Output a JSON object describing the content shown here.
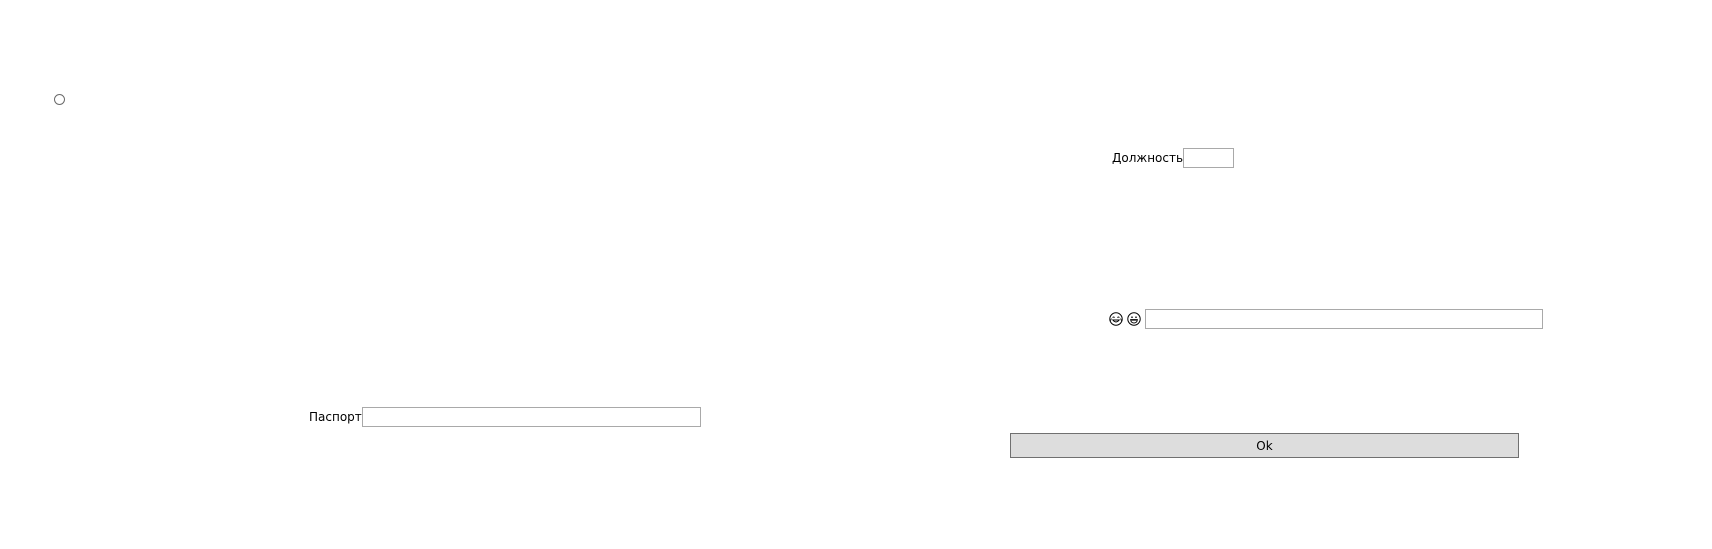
{
  "radio": {
    "checked": false
  },
  "position_field": {
    "label": "Должность",
    "value": "",
    "placeholder": ""
  },
  "emoji_field": {
    "icons": [
      "crying-laughing-face-icon",
      "grinning-face-icon"
    ],
    "value": "",
    "placeholder": ""
  },
  "passport_field": {
    "label": "Паспорт",
    "value": "",
    "placeholder": ""
  },
  "ok_button": {
    "label": "Ok"
  },
  "colors": {
    "button_bg": "#dddddd",
    "input_border": "#a9a9a9",
    "background": "#ffffff"
  }
}
